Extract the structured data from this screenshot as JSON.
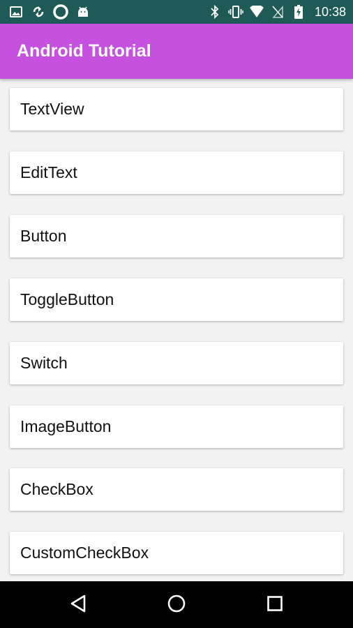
{
  "status_bar": {
    "time": "10:38",
    "left_icons": [
      "image-icon",
      "sync-icon",
      "circle-notification-icon",
      "android-icon"
    ],
    "right_icons": [
      "bluetooth-icon",
      "vibrate-icon",
      "wifi-icon",
      "no-sim-icon",
      "battery-charging-icon"
    ]
  },
  "app_bar": {
    "title": "Android Tutorial",
    "color": "#c651df"
  },
  "list": {
    "items": [
      {
        "label": "TextView"
      },
      {
        "label": "EditText"
      },
      {
        "label": "Button"
      },
      {
        "label": "ToggleButton"
      },
      {
        "label": "Switch"
      },
      {
        "label": "ImageButton"
      },
      {
        "label": "CheckBox"
      },
      {
        "label": "CustomCheckBox"
      }
    ]
  },
  "nav_bar": {
    "buttons": [
      "back-icon",
      "home-icon",
      "recents-icon"
    ]
  }
}
